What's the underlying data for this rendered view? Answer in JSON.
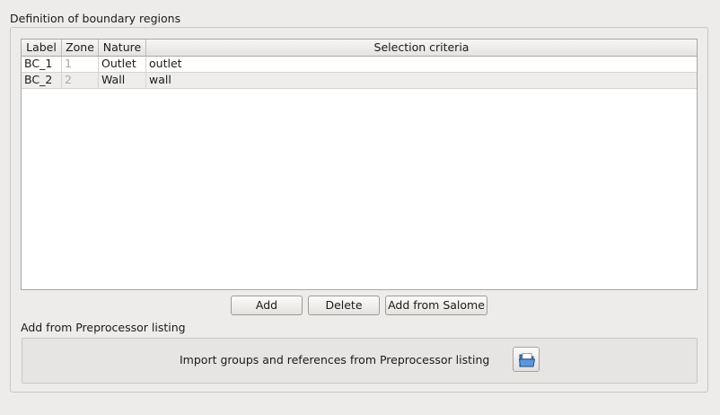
{
  "group": {
    "title": "Definition of boundary regions"
  },
  "table": {
    "headers": [
      "Label",
      "Zone",
      "Nature",
      "Selection criteria"
    ],
    "rows": [
      {
        "label": "BC_1",
        "zone": "1",
        "nature": "Outlet",
        "criteria": "outlet"
      },
      {
        "label": "BC_2",
        "zone": "2",
        "nature": "Wall",
        "criteria": "wall"
      }
    ]
  },
  "buttons": {
    "add": "Add",
    "delete": "Delete",
    "add_salome": "Add from Salome"
  },
  "preprocessor": {
    "title": "Add from Preprocessor listing",
    "import_label": "Import groups and references from Preprocessor listing",
    "icon": "open-folder-icon"
  },
  "colors": {
    "window_bg": "#edeceb",
    "table_bg": "#ffffff",
    "alt_row": "#eeedec",
    "zone_text": "#a9a9a9"
  }
}
